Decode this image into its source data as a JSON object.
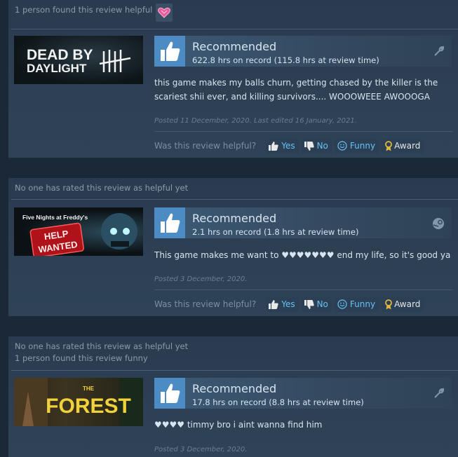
{
  "reviews": [
    {
      "helpful_lines": [
        "1 person found this review helpful"
      ],
      "game": "DEAD BY DAYLIGHT",
      "capsule_lines": [
        "DEAD BY",
        "DAYLIGHT"
      ],
      "recommendation": "Recommended",
      "hours": "622.8 hrs on record (115.8 hrs at review time)",
      "text_lines": [
        "this game makes my balls churn, getting chased by the killer is the",
        "scariest shii ever, and killing survivors.... WOOOWEEE AWOOOGA"
      ],
      "posted": "Posted 11 December, 2020. Last edited 16 January, 2021.",
      "corner_icon": "wrench-icon"
    },
    {
      "helpful_lines": [
        "No one has rated this review as helpful yet"
      ],
      "game": "Five Nights at Freddy's Help Wanted",
      "capsule_lines": [
        "Five Nights at Freddy's",
        "HELP",
        "WANTED"
      ],
      "recommendation": "Recommended",
      "hours": "2.1 hrs on record (1.8 hrs at review time)",
      "text_lines": [
        "This game makes me want to ♥♥♥♥♥♥♥ end my life, so it's good ya"
      ],
      "posted": "Posted 3 December, 2020.",
      "corner_icon": "steam-icon"
    },
    {
      "helpful_lines": [
        "No one has rated this review as helpful yet",
        "1 person found this review funny"
      ],
      "game": "THE FOREST",
      "capsule_lines": [
        "THE",
        "FOREST"
      ],
      "recommendation": "Recommended",
      "hours": "17.8 hrs on record (8.8 hrs at review time)",
      "text_lines": [
        "♥♥♥♥ timmy bro i aint wanna find him"
      ],
      "posted": "Posted 3 December, 2020.",
      "corner_icon": "wrench-icon"
    }
  ],
  "controls": {
    "question": "Was this review helpful?",
    "yes": "Yes",
    "no": "No",
    "funny": "Funny",
    "award": "Award"
  },
  "colors": {
    "background": "#1b2838",
    "thumb_blue": "#4c8bc3",
    "link_blue": "#67c1f5",
    "award_gold": "#e0b83a"
  }
}
